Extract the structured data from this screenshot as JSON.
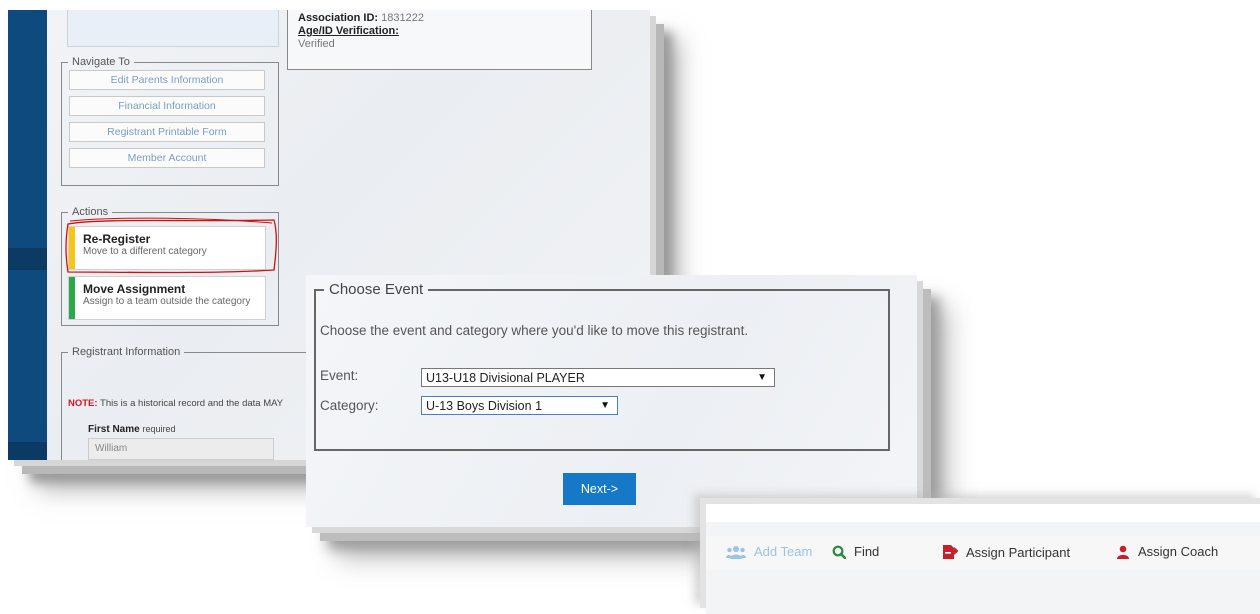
{
  "panel1": {
    "association": {
      "id_label": "Association ID:",
      "id_value": "1831222",
      "age_label": "Age/ID Verification:",
      "age_value": "Verified"
    },
    "navigate": {
      "legend": "Navigate To",
      "items": [
        "Edit Parents Information",
        "Financial Information",
        "Registrant Printable Form",
        "Member Account"
      ]
    },
    "actions": {
      "legend": "Actions",
      "items": [
        {
          "title": "Re-Register",
          "subtitle": "Move to a different category",
          "color": "#f5c518"
        },
        {
          "title": "Move Assignment",
          "subtitle": "Assign to a team outside the category",
          "color": "#2aa84a"
        }
      ]
    },
    "registrant": {
      "legend": "Registrant Information",
      "note_label": "NOTE:",
      "note_text": "This is a historical record and the data MAY",
      "first_name_label": "First Name",
      "required": "required",
      "first_name_value": "William"
    }
  },
  "panel2": {
    "legend": "Choose Event",
    "description": "Choose the event and category where you'd like to move this registrant.",
    "event_label": "Event:",
    "event_value": "U13-U18 Divisional PLAYER",
    "category_label": "Category:",
    "category_value": "U-13 Boys Division 1",
    "next_label": "Next->"
  },
  "panel3": {
    "tools": [
      {
        "label": "Add Team",
        "icon": "users-icon",
        "color": "#9cc3e3"
      },
      {
        "label": "Find",
        "icon": "search-icon",
        "color": "#2a8a3a"
      },
      {
        "label": "Assign Participant",
        "icon": "file-export-icon",
        "color": "#c8202a"
      },
      {
        "label": "Assign Coach",
        "icon": "user-icon",
        "color": "#c8202a"
      }
    ]
  }
}
